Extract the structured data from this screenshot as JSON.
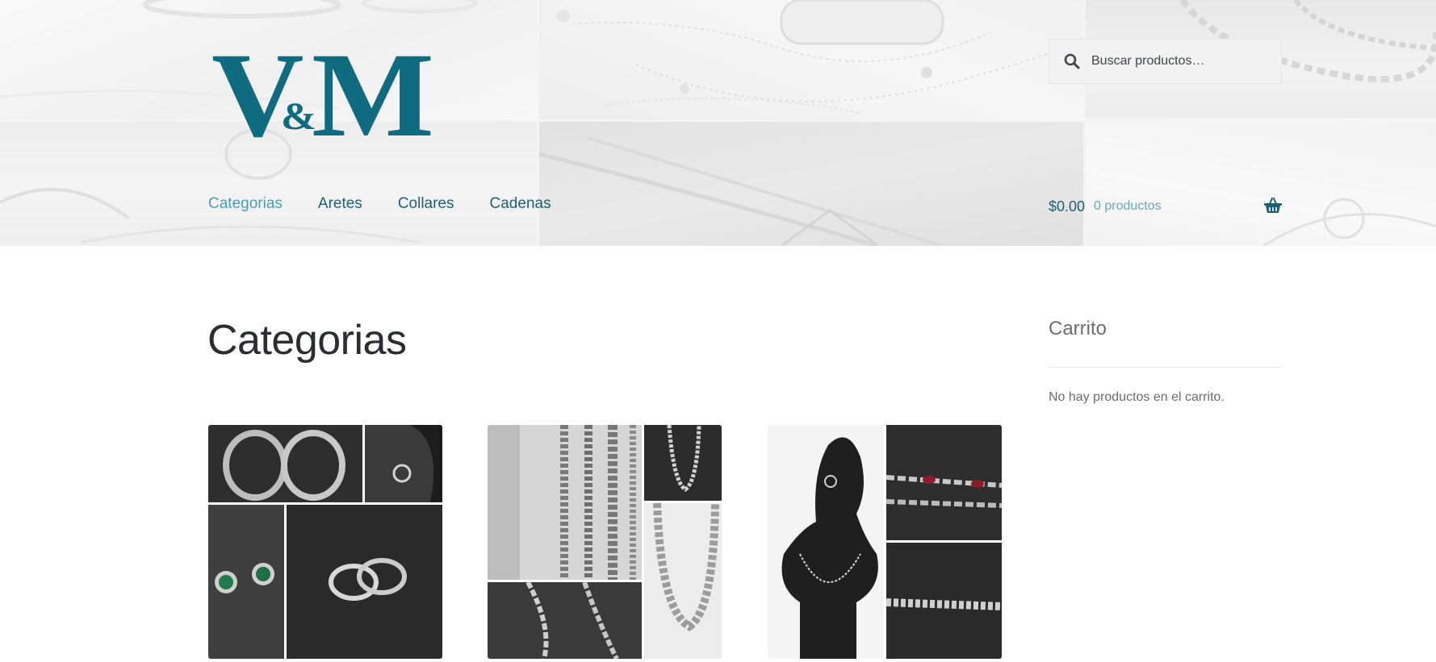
{
  "brand": {
    "logo_text": "V&M",
    "color": "#0e6b80"
  },
  "search": {
    "placeholder": "Buscar productos…"
  },
  "nav": {
    "items": [
      {
        "label": "Categorias",
        "active": true
      },
      {
        "label": "Aretes",
        "active": false
      },
      {
        "label": "Collares",
        "active": false
      },
      {
        "label": "Cadenas",
        "active": false
      }
    ]
  },
  "header_cart": {
    "amount": "$0.00",
    "count": "0 productos"
  },
  "main": {
    "title": "Categorias",
    "categories": [
      {
        "image": "earrings-collage"
      },
      {
        "image": "chains-collage"
      },
      {
        "image": "necklaces-collage"
      }
    ]
  },
  "sidebar": {
    "widget_title": "Carrito",
    "empty_message": "No hay productos en el carrito."
  },
  "colors": {
    "link": "#1e5f74",
    "link_active": "#4a9db5",
    "text": "#43454b"
  }
}
